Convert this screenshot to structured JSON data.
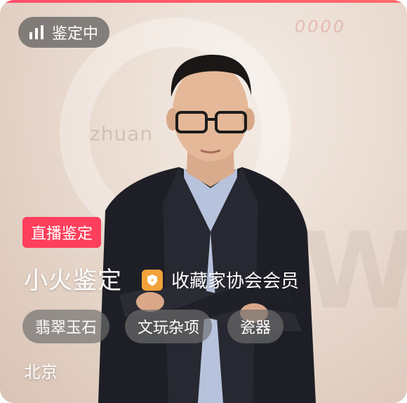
{
  "status": {
    "label": "鉴定中",
    "icon": "bar-chart-icon"
  },
  "live_badge": "直播鉴定",
  "expert": {
    "name": "小火鉴定",
    "certification": "收藏家协会会员",
    "certification_icon": "shield-icon",
    "location": "北京"
  },
  "categories": [
    "翡翠玉石",
    "文玩杂项",
    "瓷器"
  ],
  "colors": {
    "accent": "#ff3f5b",
    "badge_icon": "#f2a23a"
  }
}
